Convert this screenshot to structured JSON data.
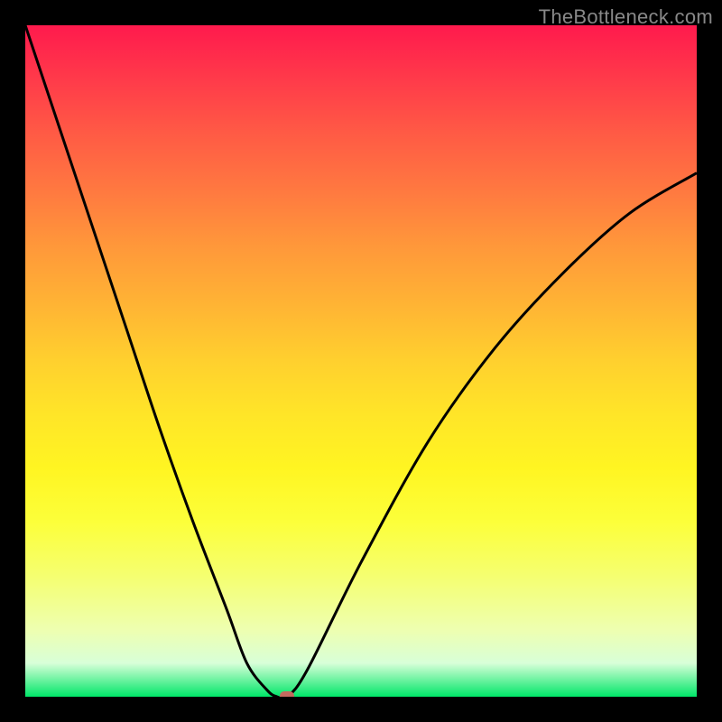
{
  "watermark": "TheBottleneck.com",
  "chart_data": {
    "type": "line",
    "title": "",
    "xlabel": "",
    "ylabel": "",
    "xlim": [
      0,
      100
    ],
    "ylim": [
      0,
      100
    ],
    "series": [
      {
        "name": "bottleneck-curve",
        "x": [
          0,
          5,
          10,
          15,
          20,
          25,
          30,
          33,
          36,
          37.5,
          39,
          42,
          50,
          60,
          70,
          80,
          90,
          100
        ],
        "values": [
          100,
          85,
          70,
          55,
          40,
          26,
          13,
          5,
          1,
          0,
          0,
          4,
          20,
          38,
          52,
          63,
          72,
          78
        ]
      }
    ],
    "marker": {
      "x": 39,
      "y": 0,
      "label": "optimal-point"
    },
    "grid": false,
    "legend": false,
    "background_gradient": {
      "top_color": "#ff1a4d",
      "bottom_color": "#00e668",
      "stops": [
        "red",
        "orange",
        "yellow",
        "green"
      ]
    }
  }
}
